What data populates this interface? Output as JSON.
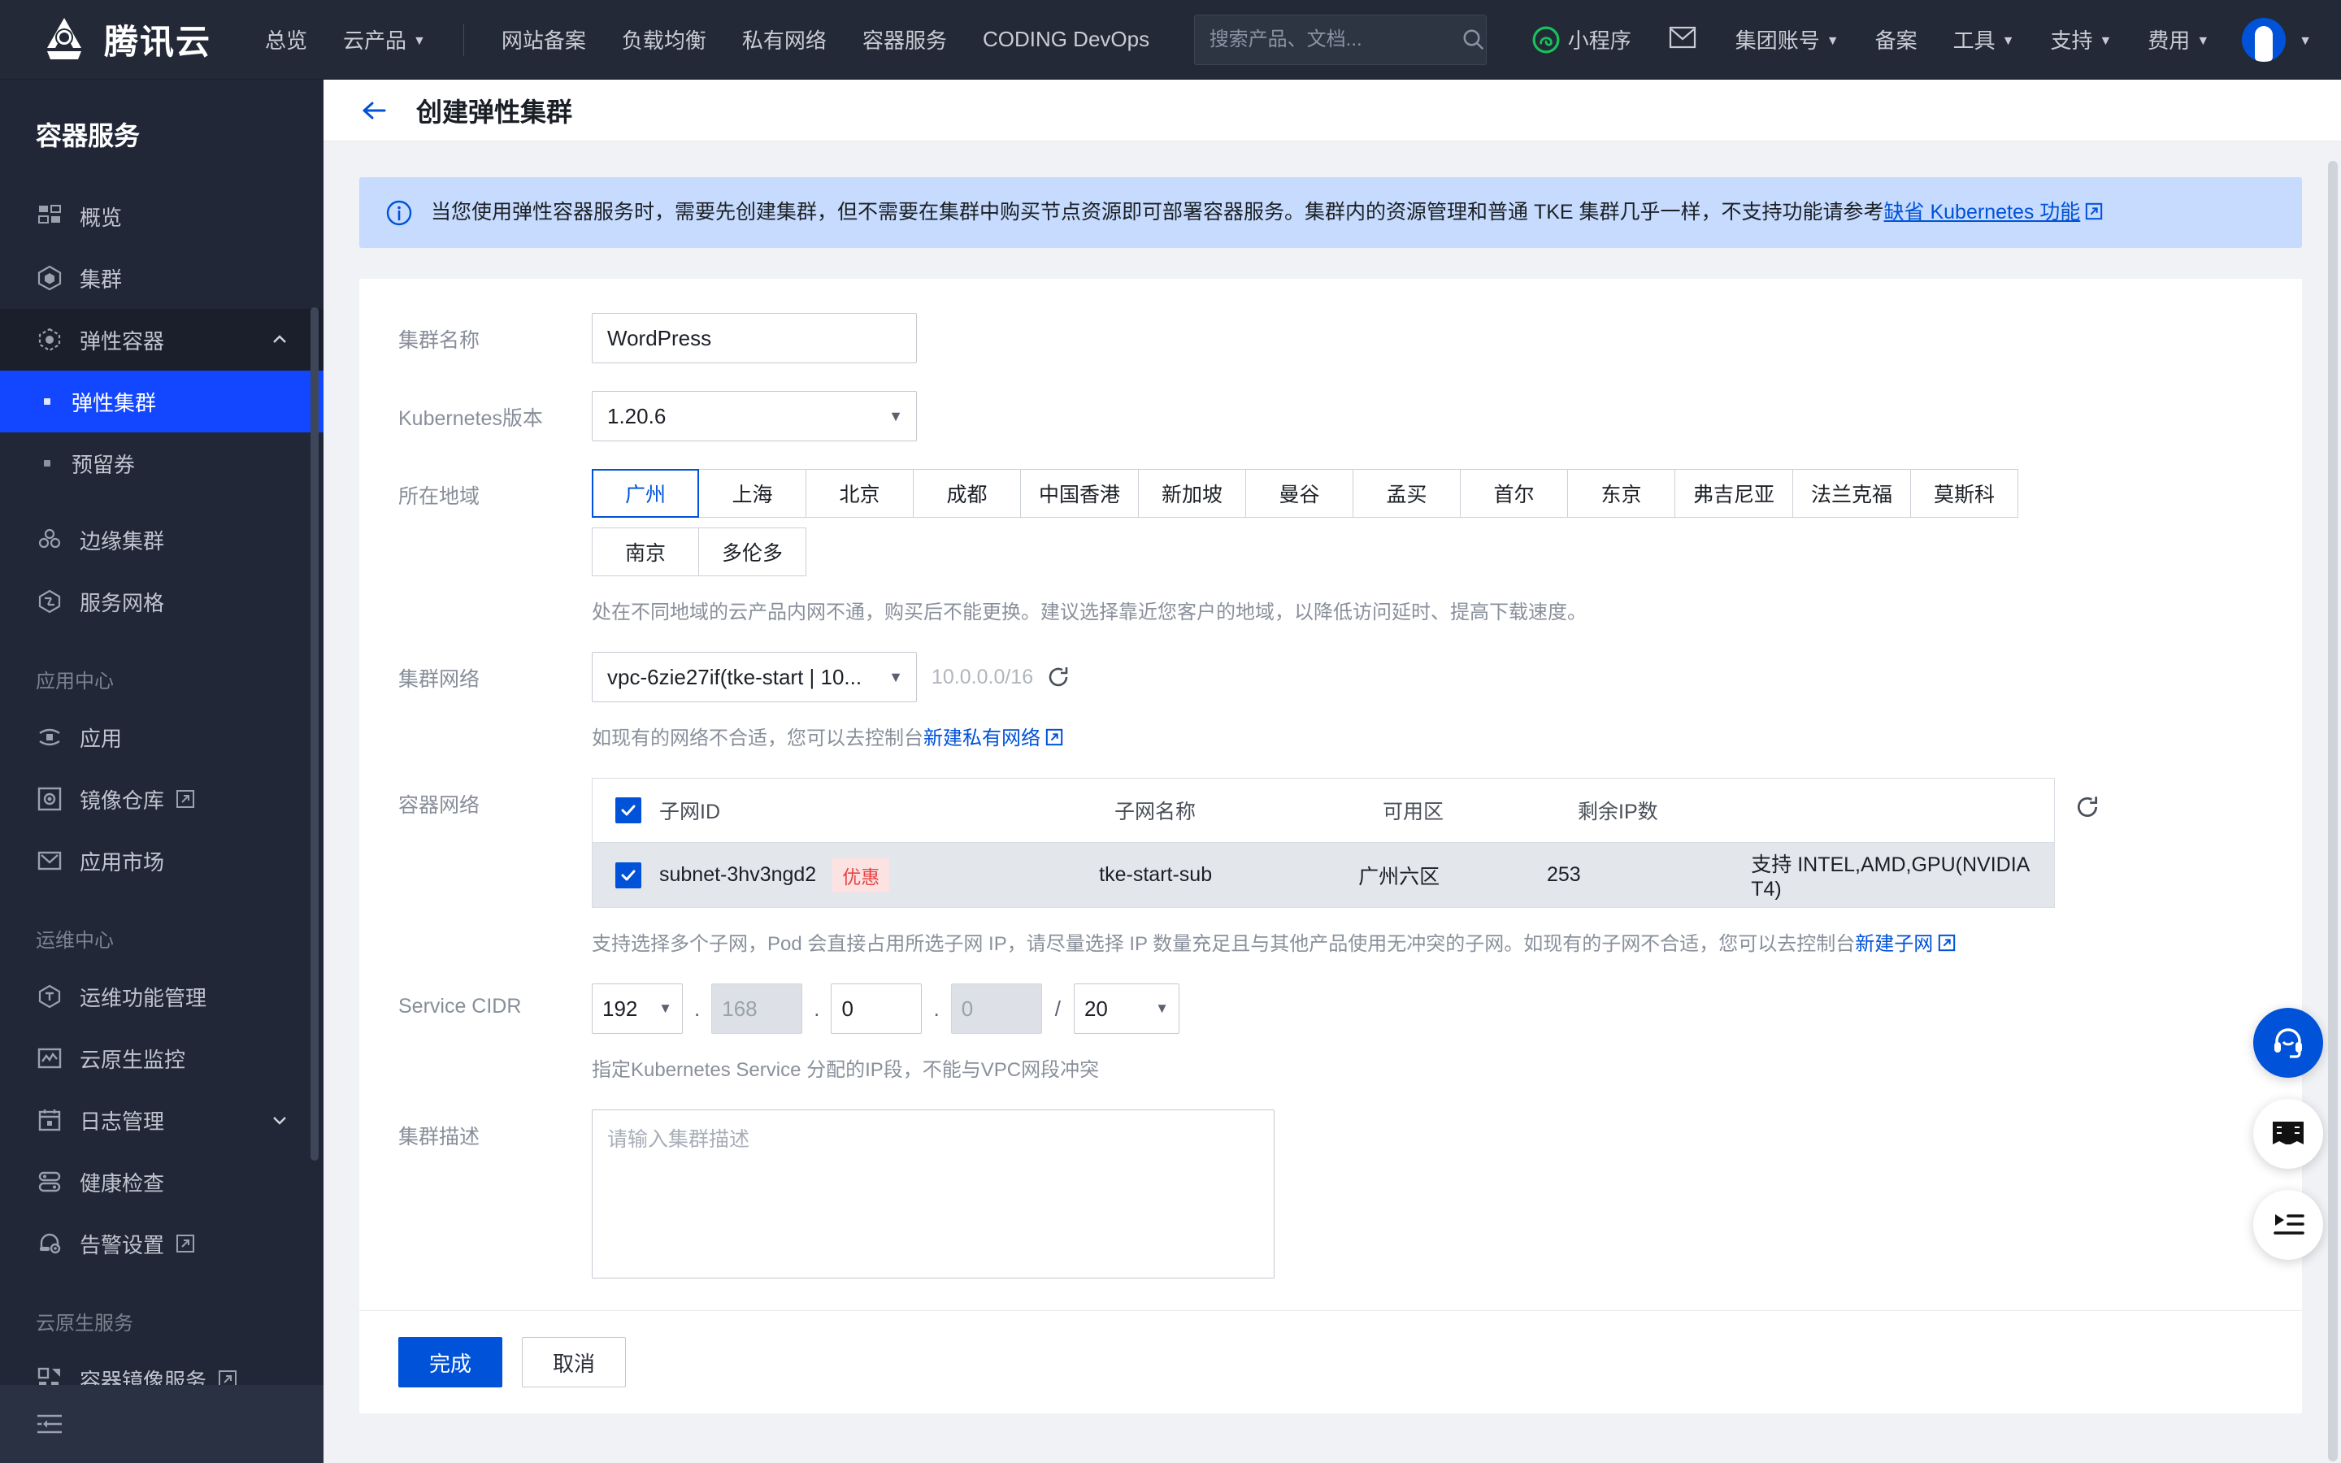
{
  "topnav": {
    "logo_text": "腾讯云",
    "links": [
      {
        "label": "总览",
        "caret": false
      },
      {
        "label": "云产品",
        "caret": true
      }
    ],
    "quick_links": [
      {
        "label": "网站备案"
      },
      {
        "label": "负载均衡"
      },
      {
        "label": "私有网络"
      },
      {
        "label": "容器服务"
      },
      {
        "label": "CODING DevOps"
      }
    ],
    "search": {
      "placeholder": "搜索产品、文档...",
      "value": ""
    },
    "mini_program": "小程序",
    "right_links": [
      {
        "label": "集团账号",
        "caret": true
      },
      {
        "label": "备案",
        "caret": false
      },
      {
        "label": "工具",
        "caret": true
      },
      {
        "label": "支持",
        "caret": true
      },
      {
        "label": "费用",
        "caret": true
      }
    ]
  },
  "sidebar": {
    "title": "容器服务",
    "items": [
      {
        "label": "概览",
        "icon": "grid-icon",
        "type": "item"
      },
      {
        "label": "集群",
        "icon": "cluster-icon",
        "type": "item"
      },
      {
        "label": "弹性容器",
        "icon": "elastic-container-icon",
        "type": "expandable",
        "expanded": true
      },
      {
        "label": "弹性集群",
        "type": "sub",
        "active": true
      },
      {
        "label": "预留券",
        "type": "sub",
        "active": false
      },
      {
        "label": "边缘集群",
        "icon": "edge-cluster-icon",
        "type": "item"
      },
      {
        "label": "服务网格",
        "icon": "mesh-icon",
        "type": "item"
      },
      {
        "label": "应用中心",
        "type": "group"
      },
      {
        "label": "应用",
        "icon": "app-icon",
        "type": "item"
      },
      {
        "label": "镜像仓库",
        "icon": "registry-icon",
        "type": "item",
        "external": true
      },
      {
        "label": "应用市场",
        "icon": "market-icon",
        "type": "item"
      },
      {
        "label": "运维中心",
        "type": "group"
      },
      {
        "label": "运维功能管理",
        "icon": "ops-icon",
        "type": "item"
      },
      {
        "label": "云原生监控",
        "icon": "monitor-icon",
        "type": "item"
      },
      {
        "label": "日志管理",
        "icon": "log-icon",
        "type": "expandable",
        "expanded": false
      },
      {
        "label": "健康检查",
        "icon": "health-icon",
        "type": "item"
      },
      {
        "label": "告警设置",
        "icon": "alarm-icon",
        "type": "item",
        "external": true
      },
      {
        "label": "云原生服务",
        "type": "group"
      },
      {
        "label": "容器镜像服务",
        "icon": "image-service-icon",
        "type": "item",
        "external": true
      }
    ]
  },
  "page": {
    "title": "创建弹性集群",
    "banner": {
      "text_before": "当您使用弹性容器服务时，需要先创建集群，但不需要在集群中购买节点资源即可部署容器服务。集群内的资源管理和普通 TKE 集群几乎一样，不支持功能请参考",
      "link": "缺省 Kubernetes 功能"
    }
  },
  "form": {
    "cluster_name": {
      "label": "集群名称",
      "value": "WordPress",
      "placeholder": ""
    },
    "k8s_version": {
      "label": "Kubernetes版本",
      "value": "1.20.6"
    },
    "region": {
      "label": "所在地域",
      "selected": "广州",
      "row1": [
        "广州",
        "上海",
        "北京",
        "成都",
        "中国香港",
        "新加坡",
        "曼谷",
        "孟买",
        "首尔",
        "东京",
        "弗吉尼亚",
        "法兰克福",
        "莫斯科"
      ],
      "row2": [
        "南京",
        "多伦多"
      ],
      "hint": "处在不同地域的云产品内网不通，购买后不能更换。建议选择靠近您客户的地域，以降低访问延时、提高下载速度。"
    },
    "cluster_network": {
      "label": "集群网络",
      "value": "vpc-6zie27if(tke-start | 10...",
      "cidr_note": "10.0.0.0/16",
      "hint_prefix": "如现有的网络不合适，您可以去控制台",
      "hint_link": "新建私有网络"
    },
    "container_network": {
      "label": "容器网络",
      "columns": [
        "子网ID",
        "子网名称",
        "可用区",
        "剩余IP数",
        ""
      ],
      "rows": [
        {
          "checked": true,
          "subnet_id": "subnet-3hv3ngd2",
          "badge": "优惠",
          "subnet_name": "tke-start-sub",
          "zone": "广州六区",
          "remaining_ip": "253",
          "support": "支持 INTEL,AMD,GPU(NVIDIA T4)"
        }
      ],
      "header_checked": true,
      "hint_prefix": "支持选择多个子网，Pod 会直接占用所选子网 IP，请尽量选择 IP 数量充足且与其他产品使用无冲突的子网。如现有的子网不合适，您可以去控制台",
      "hint_link": "新建子网"
    },
    "service_cidr": {
      "label": "Service CIDR",
      "octet1": {
        "value": "192",
        "disabled": false,
        "dropdown": true
      },
      "octet2": {
        "value": "168",
        "disabled": true,
        "dropdown": false
      },
      "octet3": {
        "value": "0",
        "disabled": false,
        "dropdown": false
      },
      "octet4": {
        "value": "0",
        "disabled": true,
        "dropdown": false
      },
      "mask": {
        "value": "20",
        "dropdown": true
      },
      "hint": "指定Kubernetes Service 分配的IP段，不能与VPC网段冲突"
    },
    "cluster_desc": {
      "label": "集群描述",
      "value": "",
      "placeholder": "请输入集群描述"
    }
  },
  "footer": {
    "submit_label": "完成",
    "cancel_label": "取消"
  },
  "fabs": [
    {
      "icon": "headset-icon",
      "primary": true
    },
    {
      "icon": "book-icon",
      "primary": false
    },
    {
      "icon": "feedback-list-icon",
      "primary": false
    }
  ],
  "colors": {
    "accent": "#0052d9",
    "sidebar_bg": "#212736",
    "topnav_bg": "#232936",
    "active_item": "#1247ff",
    "banner_bg": "#c6dbfd",
    "badge_red": "#e54545"
  }
}
